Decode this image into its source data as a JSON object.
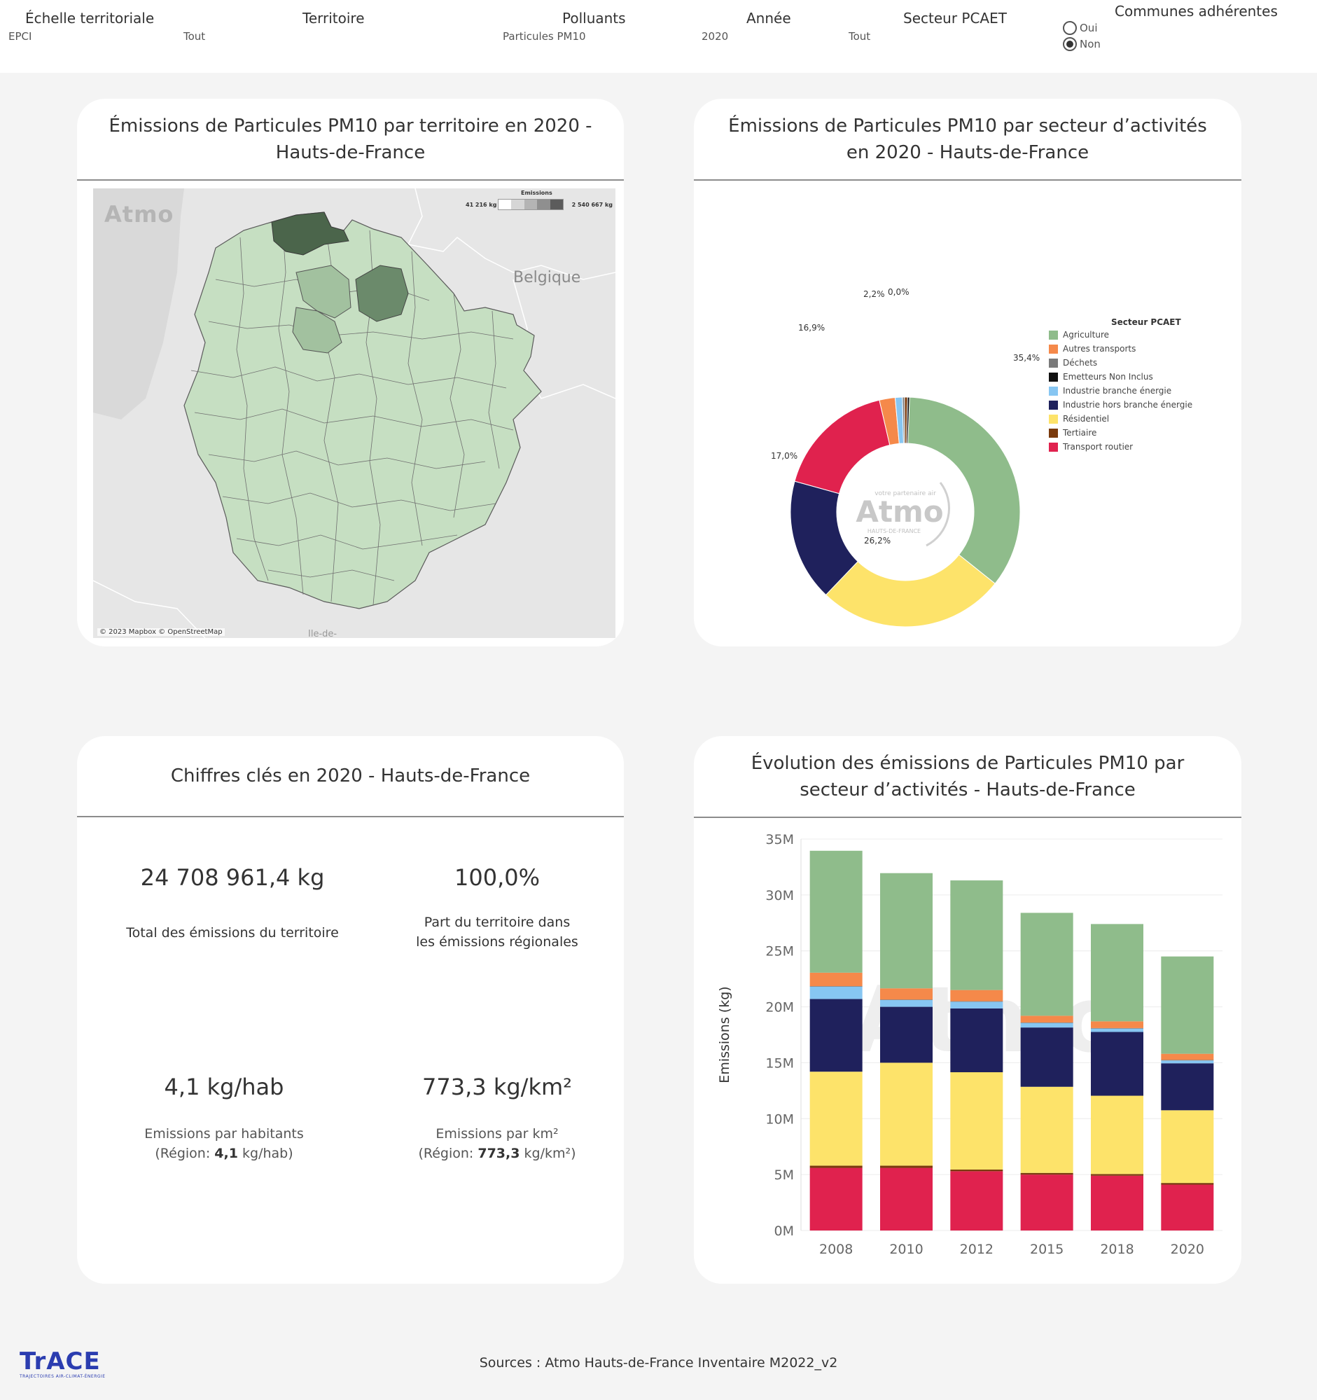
{
  "filters": {
    "echelle": {
      "label": "Échelle territoriale",
      "value": "EPCI",
      "value2": "Tout"
    },
    "territoire": {
      "label": "Territoire"
    },
    "polluants": {
      "label": "Polluants",
      "value": "Particules PM10"
    },
    "annee": {
      "label": "Année",
      "value": "2020"
    },
    "secteur": {
      "label": "Secteur PCAET",
      "value": "Tout"
    },
    "communes": {
      "label": "Communes adhérentes",
      "options": [
        "Oui",
        "Non"
      ],
      "selected": "Non"
    }
  },
  "map_card": {
    "title": "Émissions de Particules PM10 par territoire en 2020 - Hauts-de-France",
    "legend_title": "Emissions",
    "legend_min": "41 216 kg",
    "legend_max": "2 540 667 kg",
    "label_country": "Belgique",
    "label_south": "Ile-de-",
    "watermark": "Atmo",
    "attribution": "© 2023 Mapbox © OpenStreetMap",
    "fill_colors": [
      "#c6dfc2",
      "#a2c19f",
      "#6b8a6b",
      "#4b654b"
    ]
  },
  "donut_card": {
    "title": "Émissions de Particules PM10 par secteur d’activités en 2020 - Hauts-de-France",
    "legend_title": "Secteur PCAET",
    "watermark": "Atmo",
    "watermark_sub": "HAUTS-DE-FRANCE",
    "watermark_top": "votre partenaire air",
    "chart_data": {
      "type": "pie",
      "series": [
        {
          "name": "Agriculture",
          "value": 35.4,
          "color": "#8fbc8b",
          "label": "35,4%"
        },
        {
          "name": "Autres transports",
          "value": 2.2,
          "color": "#f5894a",
          "label": "2,2%"
        },
        {
          "name": "Déchets",
          "value": 0.0,
          "color": "#7a7a7a",
          "label": ""
        },
        {
          "name": "Emetteurs Non Inclus",
          "value": 0.0,
          "color": "#111111",
          "label": "0,0%"
        },
        {
          "name": "Industrie branche énergie",
          "value": 1.0,
          "color": "#87c6f2",
          "label": ""
        },
        {
          "name": "Industrie hors branche énergie",
          "value": 17.0,
          "color": "#1f215c",
          "label": "17,0%"
        },
        {
          "name": "Résidentiel",
          "value": 26.2,
          "color": "#fde36a",
          "label": "26,2%"
        },
        {
          "name": "Tertiaire",
          "value": 0.4,
          "color": "#7a3a0c",
          "label": ""
        },
        {
          "name": "Transport routier",
          "value": 16.9,
          "color": "#e0224e",
          "label": "16,9%"
        }
      ],
      "donut_order": [
        "Agriculture",
        "Résidentiel",
        "Industrie hors branche énergie",
        "Transport routier",
        "Autres transports",
        "Industrie branche énergie",
        "Déchets",
        "Tertiaire",
        "Emetteurs Non Inclus"
      ]
    }
  },
  "kpi_card": {
    "title": "Chiffres clés en 2020 - Hauts-de-France",
    "total": {
      "value": "24 708 961,4",
      "unit": "kg",
      "desc": "Total des émissions du territoire"
    },
    "part": {
      "value": "100,0%",
      "desc1": "Part du territoire dans",
      "desc2": "les émissions régionales"
    },
    "hab": {
      "value": "4,1",
      "unit": "kg/hab",
      "desc": "Emissions par habitants",
      "region_prefix": "(Région:",
      "region_value": "4,1",
      "region_unit": "kg/hab)"
    },
    "km2": {
      "value": "773,3",
      "unit": "kg/km²",
      "desc": "Emissions par km²",
      "region_prefix": "(Région:",
      "region_value": "773,3",
      "region_unit": "kg/km²)"
    }
  },
  "bar_card": {
    "title": "Évolution des émissions de Particules PM10 par secteur d’activités - Hauts-de-France",
    "chart_data": {
      "type": "bar",
      "stacked": true,
      "categories": [
        "2008",
        "2010",
        "2012",
        "2015",
        "2018",
        "2020"
      ],
      "ylabel": "Emissions (kg)",
      "ylim": [
        0,
        35000000
      ],
      "yticks": [
        {
          "value": 0,
          "label": "0M"
        },
        {
          "value": 5000000,
          "label": "5M"
        },
        {
          "value": 10000000,
          "label": "10M"
        },
        {
          "value": 15000000,
          "label": "15M"
        },
        {
          "value": 20000000,
          "label": "20M"
        },
        {
          "value": 25000000,
          "label": "25M"
        },
        {
          "value": 30000000,
          "label": "30M"
        },
        {
          "value": 35000000,
          "label": "35M"
        }
      ],
      "series": [
        {
          "name": "Transport routier",
          "color": "#e0224e",
          "values": [
            5600000,
            5600000,
            5300000,
            5000000,
            4900000,
            4100000
          ]
        },
        {
          "name": "Tertiaire",
          "color": "#7a3a0c",
          "values": [
            200000,
            200000,
            150000,
            150000,
            150000,
            150000
          ]
        },
        {
          "name": "Résidentiel",
          "color": "#fde36a",
          "values": [
            8400000,
            9200000,
            8700000,
            7700000,
            7000000,
            6500000
          ]
        },
        {
          "name": "Industrie hors branche énergie",
          "color": "#1f215c",
          "values": [
            6500000,
            5000000,
            5700000,
            5300000,
            5700000,
            4200000
          ]
        },
        {
          "name": "Industrie branche énergie",
          "color": "#87c6f2",
          "values": [
            1100000,
            600000,
            600000,
            400000,
            300000,
            250000
          ]
        },
        {
          "name": "Déchets",
          "color": "#7a7a7a",
          "values": [
            50000,
            50000,
            50000,
            50000,
            50000,
            50000
          ]
        },
        {
          "name": "Autres transports",
          "color": "#f5894a",
          "values": [
            1200000,
            1000000,
            1000000,
            600000,
            600000,
            550000
          ]
        },
        {
          "name": "Agriculture",
          "color": "#8fbc8b",
          "values": [
            10900000,
            10300000,
            9800000,
            9200000,
            8700000,
            8700000
          ]
        }
      ]
    }
  },
  "footer": {
    "sources": "Sources : Atmo Hauts-de-France Inventaire M2022_v2",
    "logo": "TrACE",
    "logo_sub": "TRAJECTOIRES AIR-CLIMAT-ÉNERGIE"
  }
}
